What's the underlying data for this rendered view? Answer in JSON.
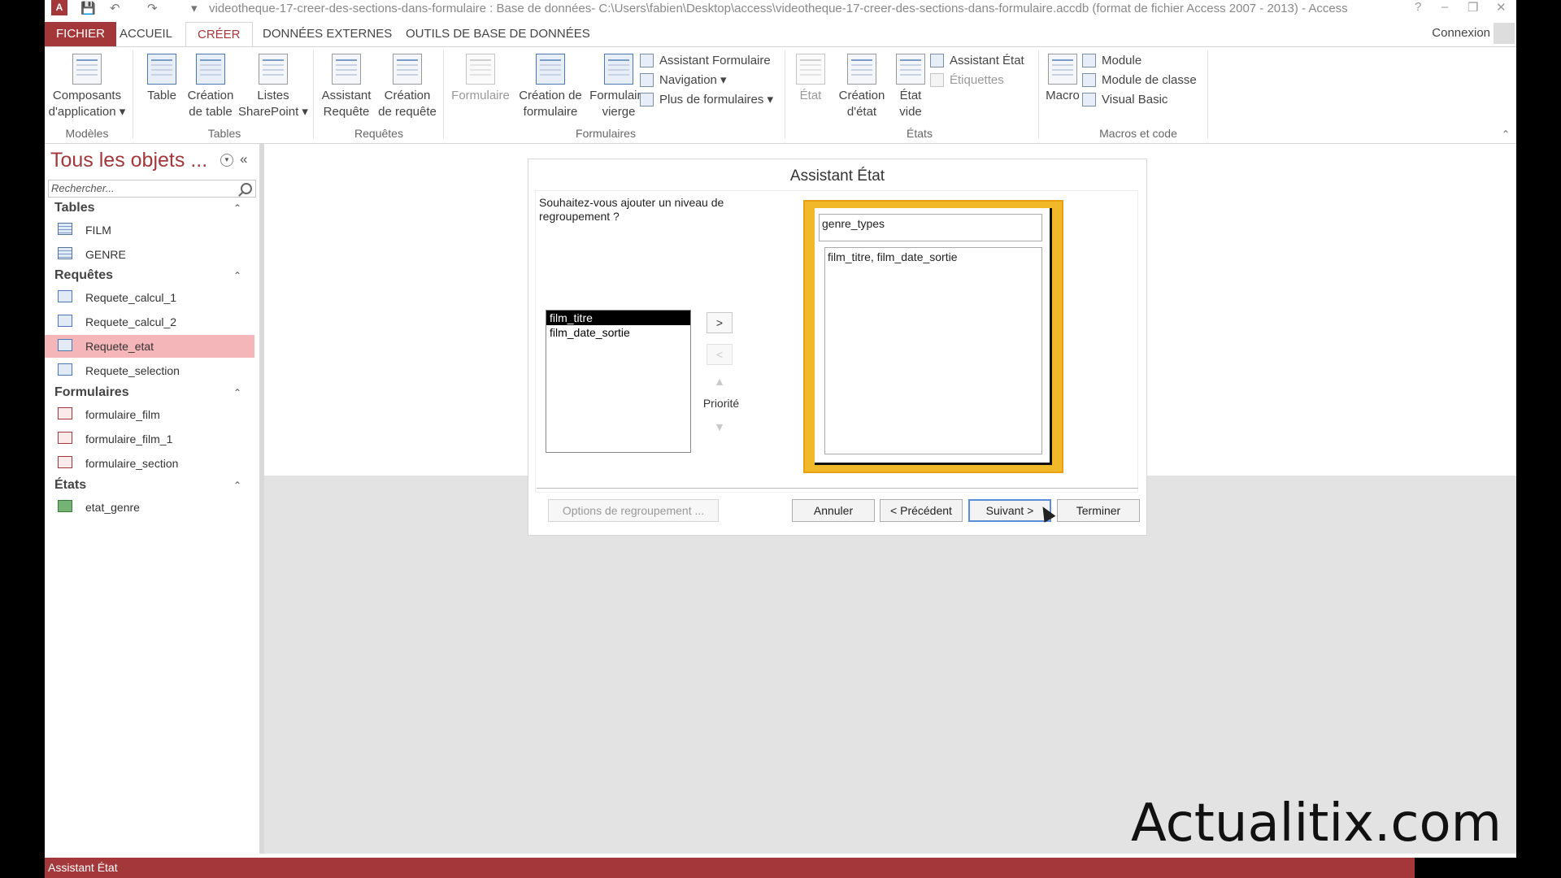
{
  "window": {
    "title": "videotheque-17-creer-des-sections-dans-formulaire : Base de données- C:\\Users\\fabien\\Desktop\\access\\videotheque-17-creer-des-sections-dans-formulaire.accdb (format de fichier Access 2007 - 2013) - Access",
    "logo": "A"
  },
  "tabs": [
    "FICHIER",
    "ACCUEIL",
    "CRÉER",
    "DONNÉES EXTERNES",
    "OUTILS DE BASE DE DONNÉES"
  ],
  "connexion": "Connexion",
  "ribbon": {
    "modeles": {
      "btn_line1": "Composants",
      "btn_line2": "d'application",
      "group": "Modèles"
    },
    "tables": {
      "table": "Table",
      "creation_1": "Création",
      "creation_2": "de table",
      "listes_1": "Listes",
      "listes_2": "SharePoint",
      "group": "Tables"
    },
    "requetes": {
      "assistant_1": "Assistant",
      "assistant_2": "Requête",
      "creation_1": "Création",
      "creation_2": "de requête",
      "group": "Requêtes"
    },
    "formulaires": {
      "formulaire": "Formulaire",
      "creation_1": "Création de",
      "creation_2": "formulaire",
      "vierge_1": "Formulaire",
      "vierge_2": "vierge",
      "assistant": "Assistant Formulaire",
      "navigation": "Navigation",
      "plus": "Plus de formulaires",
      "group": "Formulaires"
    },
    "etats": {
      "etat": "État",
      "creation_1": "Création",
      "creation_2": "d'état",
      "vide_1": "État",
      "vide_2": "vide",
      "assistant": "Assistant État",
      "etiquettes": "Étiquettes",
      "group": "États"
    },
    "macros": {
      "macro": "Macro",
      "module": "Module",
      "module_classe": "Module de classe",
      "visual_basic": "Visual Basic",
      "group": "Macros et code"
    }
  },
  "nav": {
    "header": "Tous les objets ...",
    "search_placeholder": "Rechercher...",
    "sections": {
      "tables": {
        "title": "Tables",
        "items": [
          "FILM",
          "GENRE"
        ]
      },
      "requetes": {
        "title": "Requêtes",
        "items": [
          "Requete_calcul_1",
          "Requete_calcul_2",
          "Requete_etat",
          "Requete_selection"
        ],
        "selected": "Requete_etat"
      },
      "formulaires": {
        "title": "Formulaires",
        "items": [
          "formulaire_film",
          "formulaire_film_1",
          "formulaire_section"
        ]
      },
      "etats": {
        "title": "États",
        "items": [
          "etat_genre"
        ]
      }
    }
  },
  "dialog": {
    "title": "Assistant État",
    "question": "Souhaitez-vous ajouter un niveau de regroupement ?",
    "fields": [
      "film_titre",
      "film_date_sortie"
    ],
    "selected_field": "film_titre",
    "add_label": ">",
    "remove_label": "<",
    "priority_label": "Priorité",
    "preview_group": "genre_types",
    "preview_detail": "film_titre, film_date_sortie",
    "options_button": "Options de regroupement ...",
    "cancel_button": "Annuler",
    "back_button": "< Précédent",
    "next_button": "Suivant >",
    "finish_button": "Terminer"
  },
  "status_text": "Assistant État",
  "watermark": "Actualitix.com",
  "colors": {
    "accent": "#a4373a",
    "selected_item": "#f4b6b9",
    "preview_frame": "#f1b929"
  }
}
